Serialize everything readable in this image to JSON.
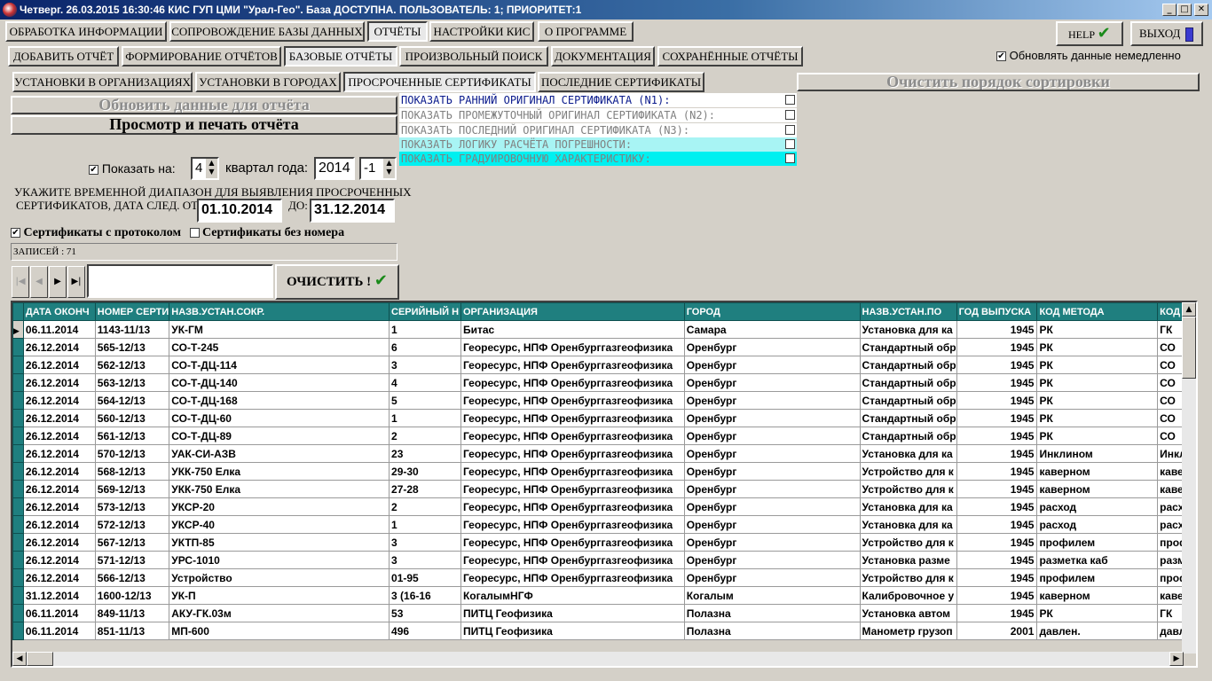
{
  "window": {
    "title": "Четверг. 26.03.2015 16:30:46 КИС ГУП ЦМИ \"Урал-Гео\". База ДОСТУПНА. ПОЛЬЗОВАТЕЛЬ: 1; ПРИОРИТЕТ:1",
    "min": "_",
    "max": "□",
    "close": "✕"
  },
  "menu": [
    "ОБРАБОТКА ИНФОРМАЦИИ",
    "СОПРОВОЖДЕНИЕ БАЗЫ ДАННЫХ",
    "ОТЧЁТЫ",
    "НАСТРОЙКИ КИС",
    "О ПРОГРАММЕ"
  ],
  "help_label": "HELP",
  "exit_label": "ВЫХОД",
  "subtabs": [
    "ДОБАВИТЬ ОТЧЁТ",
    "ФОРМИРОВАНИЕ ОТЧЁТОВ",
    "БАЗОВЫЕ ОТЧЁТЫ",
    "ПРОИЗВОЛЬНЫЙ ПОИСК",
    "ДОКУМЕНТАЦИЯ",
    "СОХРАНЁННЫЕ ОТЧЁТЫ"
  ],
  "refresh_immediately": {
    "label": "Обновлять данные немедленно",
    "checked": true
  },
  "reporttabs": [
    "УСТАНОВКИ В ОРГАНИЗАЦИЯХ",
    "УСТАНОВКИ В ГОРОДАХ",
    "ПРОСРОЧЕННЫЕ СЕРТИФИКАТЫ",
    "ПОСЛЕДНИЕ СЕРТИФИКАТЫ"
  ],
  "clear_sort_label": "Очистить порядок сортировки",
  "update_data_label": "Обновить данные для отчёта",
  "preview_print_label": "Просмотр и печать отчёта",
  "options": [
    {
      "label": "ПОКАЗАТЬ РАННИЙ ОРИГИНАЛ СЕРТИФИКАТА (N1):",
      "color": "#0a1a8c",
      "bg": "#ffffff"
    },
    {
      "label": "ПОКАЗАТЬ ПРОМЕЖУТОЧНЫЙ ОРИГИНАЛ СЕРТИФИКАТА (N2):",
      "color": "#808080",
      "bg": "#ffffff"
    },
    {
      "label": "ПОКАЗАТЬ ПОСЛЕДНИЙ ОРИГИНАЛ СЕРТИФИКАТА (N3):",
      "color": "#808080",
      "bg": "#ffffff"
    },
    {
      "label": "ПОКАЗАТЬ ЛОГИКУ РАСЧЁТА ПОГРЕШНОСТИ:",
      "color": "#808080",
      "bg": "#a8f4f4"
    },
    {
      "label": "ПОКАЗАТЬ ГРАДУИРОВОЧНУЮ ХАРАКТЕРИСТИКУ:",
      "color": "#808080",
      "bg": "#00f0f0"
    }
  ],
  "period": {
    "show_label": "Показать на:",
    "quarter": "4",
    "quarter_label": "квартал года:",
    "year": "2014",
    "offset": "-1"
  },
  "range": {
    "text1": "УКАЖИТЕ ВРЕМЕННОЙ ДИАПАЗОН ДЛЯ ВЫЯВЛЕНИЯ ПРОСРОЧЕННЫХ",
    "text2": "СЕРТИФИКАТОВ, ДАТА СЛЕД. ОТ:",
    "from": "01.10.2014",
    "to_label": "ДО:",
    "to": "31.12.2014"
  },
  "with_protocol": {
    "label": "Сертификаты с протоколом",
    "checked": true
  },
  "without_number": {
    "label": "Сертификаты без номера",
    "checked": false
  },
  "records": "ЗАПИСЕЙ : 71",
  "clear_label": "ОЧИСТИТЬ !",
  "grid": {
    "headers": [
      "ДАТА ОКОНЧ",
      "НОМЕР СЕРТИ",
      "НАЗВ.УСТАН.СОКР.",
      "СЕРИЙНЫЙ Н",
      "ОРГАНИЗАЦИЯ",
      "ГОРОД",
      "НАЗВ.УСТАН.ПО",
      "ГОД ВЫПУСКА",
      "КОД МЕТОДА",
      "КОД"
    ],
    "rows": [
      [
        "06.11.2014",
        "1143-11/13",
        "УК-ГМ",
        "1",
        "Битас",
        "Самара",
        "Установка для ка",
        "1945",
        "РК",
        "ГК"
      ],
      [
        "26.12.2014",
        "565-12/13",
        "СО-Т-245",
        "6",
        "Георесурс, НПФ Оренбурггазгеофизика",
        "Оренбург",
        "Стандартный обр",
        "1945",
        "РК",
        "СО"
      ],
      [
        "26.12.2014",
        "562-12/13",
        "СО-Т-ДЦ-114",
        "3",
        "Георесурс, НПФ Оренбурггазгеофизика",
        "Оренбург",
        "Стандартный обр",
        "1945",
        "РК",
        "СО"
      ],
      [
        "26.12.2014",
        "563-12/13",
        "СО-Т-ДЦ-140",
        "4",
        "Георесурс, НПФ Оренбурггазгеофизика",
        "Оренбург",
        "Стандартный обр",
        "1945",
        "РК",
        "СО"
      ],
      [
        "26.12.2014",
        "564-12/13",
        "СО-Т-ДЦ-168",
        "5",
        "Георесурс, НПФ Оренбурггазгеофизика",
        "Оренбург",
        "Стандартный обр",
        "1945",
        "РК",
        "СО"
      ],
      [
        "26.12.2014",
        "560-12/13",
        "СО-Т-ДЦ-60",
        "1",
        "Георесурс, НПФ Оренбурггазгеофизика",
        "Оренбург",
        "Стандартный обр",
        "1945",
        "РК",
        "СО"
      ],
      [
        "26.12.2014",
        "561-12/13",
        "СО-Т-ДЦ-89",
        "2",
        "Георесурс, НПФ Оренбурггазгеофизика",
        "Оренбург",
        "Стандартный обр",
        "1945",
        "РК",
        "СО"
      ],
      [
        "26.12.2014",
        "570-12/13",
        "УАК-СИ-АЗВ",
        "23",
        "Георесурс, НПФ Оренбурггазгеофизика",
        "Оренбург",
        "Установка для ка",
        "1945",
        "Инклином",
        "Инкл"
      ],
      [
        "26.12.2014",
        "568-12/13",
        "УКК-750 Елка",
        "29-30",
        "Георесурс, НПФ Оренбурггазгеофизика",
        "Оренбург",
        "Устройство для к",
        "1945",
        "каверном",
        "кавер"
      ],
      [
        "26.12.2014",
        "569-12/13",
        "УКК-750 Елка",
        "27-28",
        "Георесурс, НПФ Оренбурггазгеофизика",
        "Оренбург",
        "Устройство для к",
        "1945",
        "каверном",
        "кавер"
      ],
      [
        "26.12.2014",
        "573-12/13",
        "УКСР-20",
        "2",
        "Георесурс, НПФ Оренбурггазгеофизика",
        "Оренбург",
        "Установка для ка",
        "1945",
        "расход",
        "расхо"
      ],
      [
        "26.12.2014",
        "572-12/13",
        "УКСР-40",
        "1",
        "Георесурс, НПФ Оренбурггазгеофизика",
        "Оренбург",
        "Установка для ка",
        "1945",
        "расход",
        "расхо"
      ],
      [
        "26.12.2014",
        "567-12/13",
        "УКТП-85",
        "3",
        "Георесурс, НПФ Оренбурггазгеофизика",
        "Оренбург",
        "Устройство для к",
        "1945",
        "профилем",
        "профи"
      ],
      [
        "26.12.2014",
        "571-12/13",
        "УРС-1010",
        "3",
        "Георесурс, НПФ Оренбурггазгеофизика",
        "Оренбург",
        "Установка разме",
        "1945",
        "разметка каб",
        "разме"
      ],
      [
        "26.12.2014",
        "566-12/13",
        "Устройство",
        "01-95",
        "Георесурс, НПФ Оренбурггазгеофизика",
        "Оренбург",
        "Устройство для к",
        "1945",
        "профилем",
        "профи"
      ],
      [
        "31.12.2014",
        "1600-12/13",
        "УК-П",
        "3 (16-16",
        "КогалымНГФ",
        "Когалым",
        "Калибровочное у",
        "1945",
        "каверном",
        "кавер"
      ],
      [
        "06.11.2014",
        "849-11/13",
        "АКУ-ГК.03м",
        "53",
        "ПИТЦ Геофизика",
        "Полазна",
        "Установка автом",
        "1945",
        "РК",
        "ГК"
      ],
      [
        "06.11.2014",
        "851-11/13",
        "МП-600",
        "496",
        "ПИТЦ Геофизика",
        "Полазна",
        "Манометр грузоп",
        "2001",
        "давлен.",
        "давл"
      ]
    ]
  }
}
